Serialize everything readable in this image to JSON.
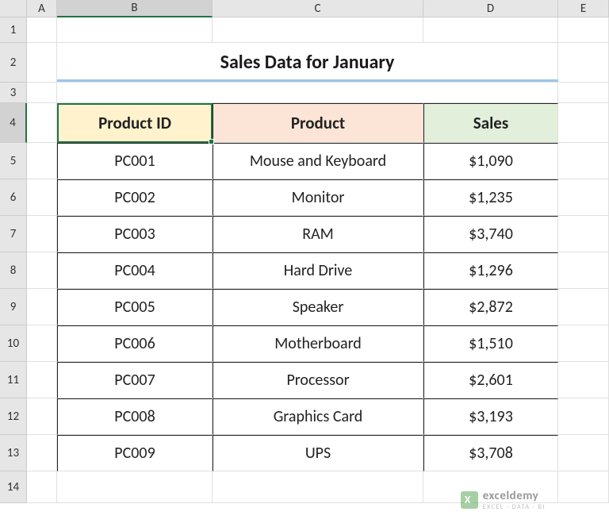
{
  "columns": [
    "A",
    "B",
    "C",
    "D",
    "E"
  ],
  "rows": [
    "1",
    "2",
    "3",
    "4",
    "5",
    "6",
    "7",
    "8",
    "9",
    "10",
    "11",
    "12",
    "13",
    "14"
  ],
  "title": "Sales Data for January",
  "headers": {
    "b": "Product ID",
    "c": "Product",
    "d": "Sales"
  },
  "data": [
    {
      "id": "PC001",
      "product": "Mouse and Keyboard",
      "sales": "$1,090"
    },
    {
      "id": "PC002",
      "product": "Monitor",
      "sales": "$1,235"
    },
    {
      "id": "PC003",
      "product": "RAM",
      "sales": "$3,740"
    },
    {
      "id": "PC004",
      "product": "Hard Drive",
      "sales": "$1,296"
    },
    {
      "id": "PC005",
      "product": "Speaker",
      "sales": "$2,872"
    },
    {
      "id": "PC006",
      "product": "Motherboard",
      "sales": "$1,510"
    },
    {
      "id": "PC007",
      "product": "Processor",
      "sales": "$2,601"
    },
    {
      "id": "PC008",
      "product": "Graphics Card",
      "sales": "$3,193"
    },
    {
      "id": "PC009",
      "product": "UPS",
      "sales": "$3,708"
    }
  ],
  "watermark": {
    "brand": "exceldemy",
    "tagline": "EXCEL · DATA · BI"
  },
  "selected": {
    "col": "B",
    "row": "4"
  }
}
